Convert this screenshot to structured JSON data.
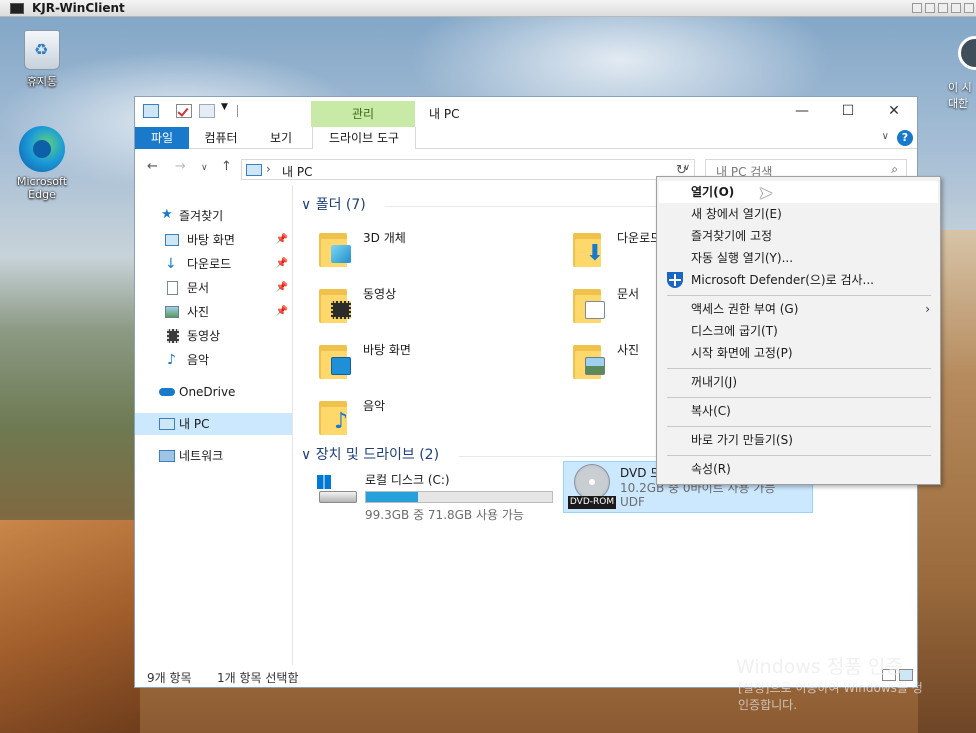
{
  "window": {
    "title": "KJR-WinClient"
  },
  "desktop": {
    "icons": [
      {
        "label": "휴지통"
      },
      {
        "label": "Microsoft Edge"
      }
    ],
    "right_text": [
      "이 시",
      "대한"
    ]
  },
  "explorer": {
    "title": "내 PC",
    "manage_tab": "관리",
    "ribbon_tabs": {
      "file": "파일",
      "computer": "컴퓨터",
      "view": "보기",
      "drive_tools": "드라이브 도구"
    },
    "address": {
      "path": "내 PC"
    },
    "search": {
      "placeholder": "내 PC 검색"
    },
    "nav": {
      "quick_access": "즐겨찾기",
      "pinned": [
        {
          "label": "바탕 화면"
        },
        {
          "label": "다운로드"
        },
        {
          "label": "문서"
        },
        {
          "label": "사진"
        }
      ],
      "unpinned": [
        {
          "label": "동영상"
        },
        {
          "label": "음악"
        }
      ],
      "onedrive": "OneDrive",
      "this_pc": "내 PC",
      "network": "네트워크"
    },
    "folders_header": "폴더 (7)",
    "folders": [
      {
        "label": "3D 개체"
      },
      {
        "label": "다운로드"
      },
      {
        "label": "동영상"
      },
      {
        "label": "문서"
      },
      {
        "label": "바탕 화면"
      },
      {
        "label": "사진"
      },
      {
        "label": "음악"
      }
    ],
    "drives_header": "장치 및 드라이브 (2)",
    "drives": [
      {
        "name": "로컬 디스크 (C:)",
        "info": "99.3GB 중 71.8GB 사용 가능",
        "used_fraction": 0.277
      },
      {
        "name": "DVD 드",
        "info": "10.2GB 중 0바이트 사용 가능",
        "fs": "UDF",
        "badge": "DVD-ROM"
      }
    ],
    "status": {
      "count": "9개 항목",
      "selected": "1개 항목 선택함"
    }
  },
  "context_menu": {
    "items": [
      {
        "label": "열기(O)"
      },
      {
        "label": "새 창에서 열기(E)"
      },
      {
        "label": "즐겨찾기에 고정"
      },
      {
        "label": "자동 실행 열기(Y)..."
      },
      {
        "label": "Microsoft Defender(으)로 검사..."
      },
      {
        "label": "액세스 권한 부여 (G)"
      },
      {
        "label": "디스크에 굽기(T)"
      },
      {
        "label": "시작 화면에 고정(P)"
      },
      {
        "label": "꺼내기(J)"
      },
      {
        "label": "복사(C)"
      },
      {
        "label": "바로 가기 만들기(S)"
      },
      {
        "label": "속성(R)"
      }
    ]
  },
  "activation": {
    "line1": "Windows 정품 인증",
    "line2": "[설정]으로 이동하여 Windows를 정",
    "line3": "인증합니다."
  },
  "colors": {
    "accent": "#1979ca",
    "manage_tab_bg": "#c9e9a6",
    "selection": "#cce8ff",
    "drive_fill": "#26a0da"
  }
}
